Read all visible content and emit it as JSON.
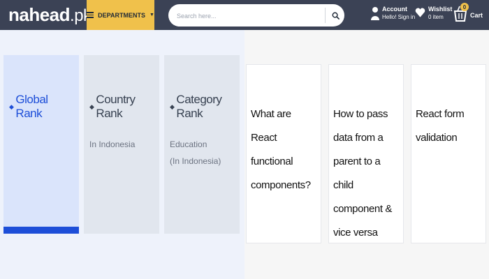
{
  "header": {
    "logo": {
      "main": "nahead",
      "suffix": ".pk"
    },
    "departments_label": "DEPARTMENTS",
    "search": {
      "placeholder": "Search here..."
    },
    "account": {
      "title": "Account",
      "subtitle": "Hello! Sign in"
    },
    "wishlist": {
      "title": "Wishlist",
      "subtitle": "0 item"
    },
    "cart": {
      "label": "Cart",
      "count": "0"
    }
  },
  "ranks": [
    {
      "title": "Global Rank",
      "sub1": "",
      "sub2": ""
    },
    {
      "title": "Country Rank",
      "sub1": "In Indonesia",
      "sub2": ""
    },
    {
      "title": "Category Rank",
      "sub1": "Education",
      "sub2": "(In Indonesia)"
    }
  ],
  "questions": [
    "What are React functional components?",
    "How to pass data from a parent to a child component & vice versa",
    "React form validation"
  ],
  "colors": {
    "header_bg": "#3b4255",
    "accent_yellow": "#f0c14b",
    "active_blue": "#1d4ed8"
  }
}
